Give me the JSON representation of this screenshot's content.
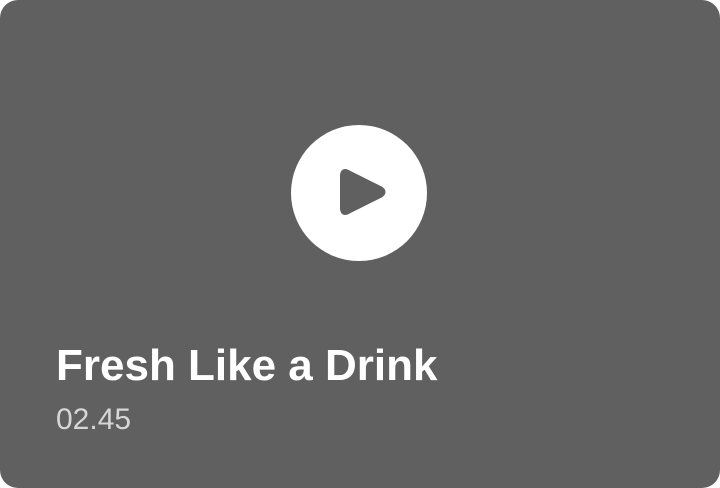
{
  "video_card": {
    "title": "Fresh Like a Drink",
    "duration": "02.45",
    "play_icon": "play-icon",
    "colors": {
      "card_background": "#606060",
      "play_button": "#ffffff",
      "play_icon": "#606060",
      "title": "#ffffff",
      "duration": "#d6d6d6"
    }
  }
}
